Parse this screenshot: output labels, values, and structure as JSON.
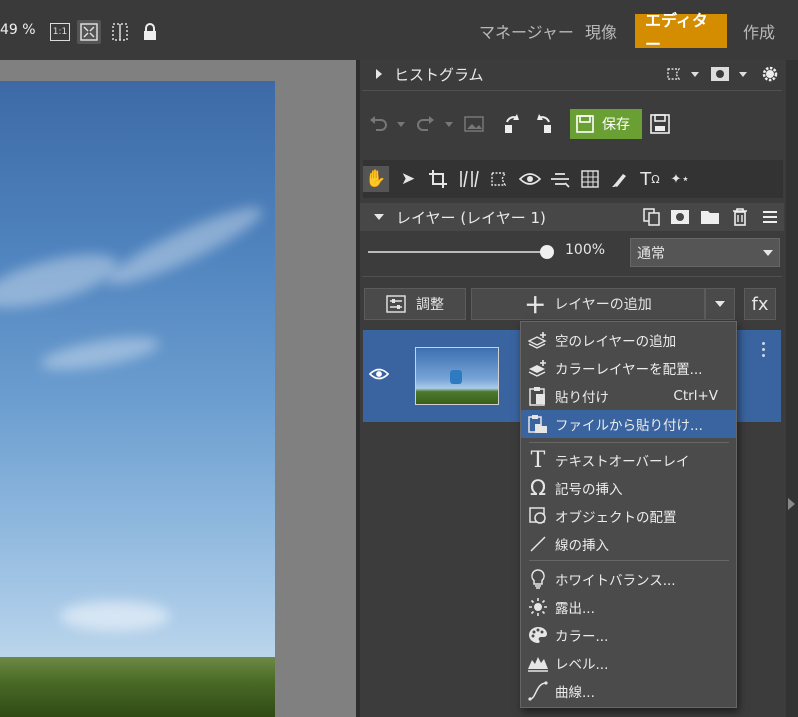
{
  "topbar": {
    "zoom": "49 %",
    "fit_label": "1:1",
    "nav_tabs": [
      "マネージャー",
      "現像",
      "エディター",
      "作成"
    ],
    "active_tab": "エディター"
  },
  "histogram": {
    "title": "ヒストグラム"
  },
  "toolbar": {
    "save_label": "保存"
  },
  "layers": {
    "title": "レイヤー (レイヤー 1)",
    "opacity": "100%",
    "blend_mode": "通常",
    "adjust_label": "調整",
    "add_layer_label": "レイヤーの追加",
    "fx_label": "fx"
  },
  "menu": {
    "items": [
      {
        "icon": "new-layer-icon",
        "label": "空のレイヤーの追加",
        "shortcut": ""
      },
      {
        "icon": "color-layer-icon",
        "label": "カラーレイヤーを配置...",
        "shortcut": ""
      },
      {
        "icon": "paste-icon",
        "label": "貼り付け",
        "shortcut": "Ctrl+V"
      },
      {
        "icon": "paste-from-file-icon",
        "label": "ファイルから貼り付け...",
        "shortcut": ""
      },
      {
        "icon": "text-icon",
        "label": "テキストオーバーレイ",
        "shortcut": ""
      },
      {
        "icon": "omega-icon",
        "label": "記号の挿入",
        "shortcut": ""
      },
      {
        "icon": "object-icon",
        "label": "オブジェクトの配置",
        "shortcut": ""
      },
      {
        "icon": "line-icon",
        "label": "線の挿入",
        "shortcut": ""
      },
      {
        "icon": "bulb-icon",
        "label": "ホワイトバランス...",
        "shortcut": ""
      },
      {
        "icon": "sun-icon",
        "label": "露出...",
        "shortcut": ""
      },
      {
        "icon": "palette-icon",
        "label": "カラー...",
        "shortcut": ""
      },
      {
        "icon": "levels-icon",
        "label": "レベル...",
        "shortcut": ""
      },
      {
        "icon": "curve-icon",
        "label": "曲線...",
        "shortcut": ""
      }
    ],
    "highlighted": "ファイルから貼り付け..."
  }
}
